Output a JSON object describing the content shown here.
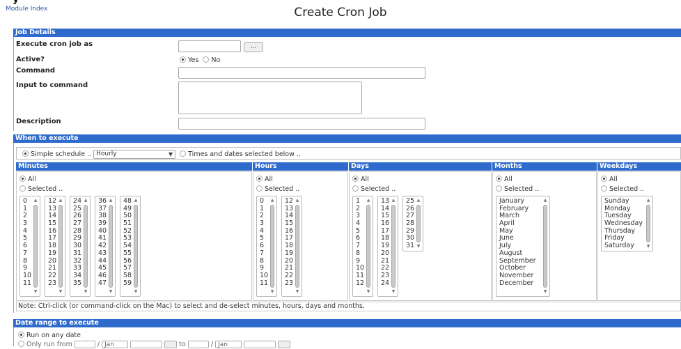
{
  "header": {
    "app_glyph": "y",
    "module_index": "Module Index",
    "title": "Create Cron Job"
  },
  "job_details": {
    "section": "Job Details",
    "execute_as_label": "Execute cron job as",
    "user_button": "...",
    "active_label": "Active?",
    "active_yes": "Yes",
    "active_no": "No",
    "command_label": "Command",
    "input_label": "Input to command",
    "description_label": "Description"
  },
  "when": {
    "section": "When to execute",
    "simple_schedule": "Simple schedule ..",
    "simple_value": "Hourly",
    "times_dates": "Times and dates selected below ..",
    "all_label": "All",
    "selected_label": "Selected ..",
    "minutes_head": "Minutes",
    "hours_head": "Hours",
    "days_head": "Days",
    "months_head": "Months",
    "weekdays_head": "Weekdays",
    "minutes_cols": [
      [
        "0",
        "1",
        "2",
        "3",
        "4",
        "5",
        "6",
        "7",
        "8",
        "9",
        "10",
        "11"
      ],
      [
        "12",
        "13",
        "14",
        "15",
        "16",
        "17",
        "18",
        "19",
        "20",
        "21",
        "22",
        "23"
      ],
      [
        "24",
        "25",
        "26",
        "27",
        "28",
        "29",
        "30",
        "31",
        "32",
        "33",
        "34",
        "35"
      ],
      [
        "36",
        "37",
        "38",
        "39",
        "40",
        "41",
        "42",
        "43",
        "44",
        "45",
        "46",
        "47"
      ],
      [
        "48",
        "49",
        "50",
        "51",
        "52",
        "53",
        "54",
        "55",
        "56",
        "57",
        "58",
        "59"
      ]
    ],
    "hours_cols": [
      [
        "0",
        "1",
        "2",
        "3",
        "4",
        "5",
        "6",
        "7",
        "8",
        "9",
        "10",
        "11"
      ],
      [
        "12",
        "13",
        "14",
        "15",
        "16",
        "17",
        "18",
        "19",
        "20",
        "21",
        "22",
        "23"
      ]
    ],
    "days_cols": [
      [
        "1",
        "2",
        "3",
        "4",
        "5",
        "6",
        "7",
        "8",
        "9",
        "10",
        "11",
        "12"
      ],
      [
        "13",
        "14",
        "15",
        "16",
        "17",
        "18",
        "19",
        "20",
        "21",
        "22",
        "23",
        "24"
      ],
      [
        "25",
        "26",
        "27",
        "28",
        "29",
        "30",
        "31"
      ]
    ],
    "months": [
      "January",
      "February",
      "March",
      "April",
      "May",
      "June",
      "July",
      "August",
      "September",
      "October",
      "November",
      "December"
    ],
    "weekdays": [
      "Sunday",
      "Monday",
      "Tuesday",
      "Wednesday",
      "Thursday",
      "Friday",
      "Saturday"
    ],
    "note": "Note: Ctrl-click (or command-click on the Mac) to select and de-select minutes, hours, days and months."
  },
  "date_range": {
    "section": "Date range to execute",
    "any_date": "Run on any date",
    "only_from": "Only run from",
    "month_from": "Jan",
    "to_label": "to",
    "month_to": "Jan",
    "sep": "/"
  }
}
